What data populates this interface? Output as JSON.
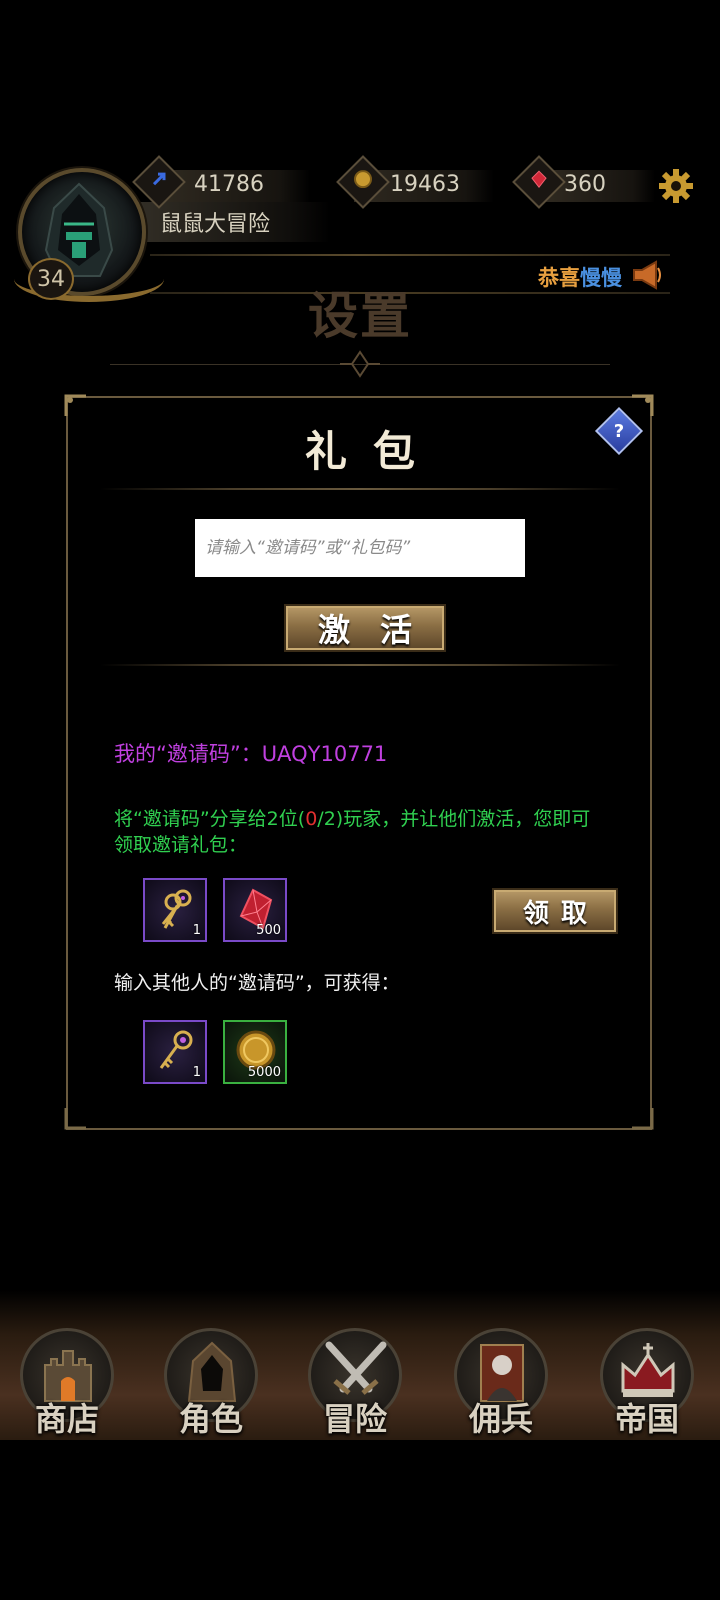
{
  "player": {
    "name": "鼠鼠大冒险",
    "level": "34"
  },
  "resources": {
    "energy": "41786",
    "gold": "19463",
    "gems": "360"
  },
  "notice": {
    "part1": "恭喜",
    "part2": "慢慢"
  },
  "page_title": "设置",
  "dialog": {
    "title": "礼包",
    "help_label": "?",
    "code_input_placeholder": "请输入“邀请码”或“礼包码”",
    "activate_label": "激活",
    "my_code_label": "我的“邀请码”：UAQY10771",
    "share_text_a": "将“邀请码”分享给2位(",
    "share_text_progress": "0",
    "share_text_b": "/2)玩家，并让他们激活，您即可领取邀请礼包：",
    "invite_rewards": [
      {
        "icon": "keys-icon",
        "count": "1"
      },
      {
        "icon": "red-gem-icon",
        "count": "500"
      }
    ],
    "claim_label": "领取",
    "enter_text": "输入其他人的“邀请码”，可获得：",
    "enter_rewards": [
      {
        "icon": "key-icon",
        "count": "1"
      },
      {
        "icon": "gold-coin-icon",
        "count": "5000"
      }
    ]
  },
  "nav": {
    "items": [
      {
        "label": "商店",
        "icon": "castle-icon"
      },
      {
        "label": "角色",
        "icon": "hood-icon"
      },
      {
        "label": "冒险",
        "icon": "crossed-swords-icon"
      },
      {
        "label": "佣兵",
        "icon": "mercenary-card-icon"
      },
      {
        "label": "帝国",
        "icon": "crown-icon"
      }
    ]
  },
  "colors": {
    "invite_code": "#c040e0",
    "share_text": "#30d050",
    "progress_red": "#e03030",
    "notice_orange": "#e8a040",
    "notice_blue": "#4a90e0"
  }
}
